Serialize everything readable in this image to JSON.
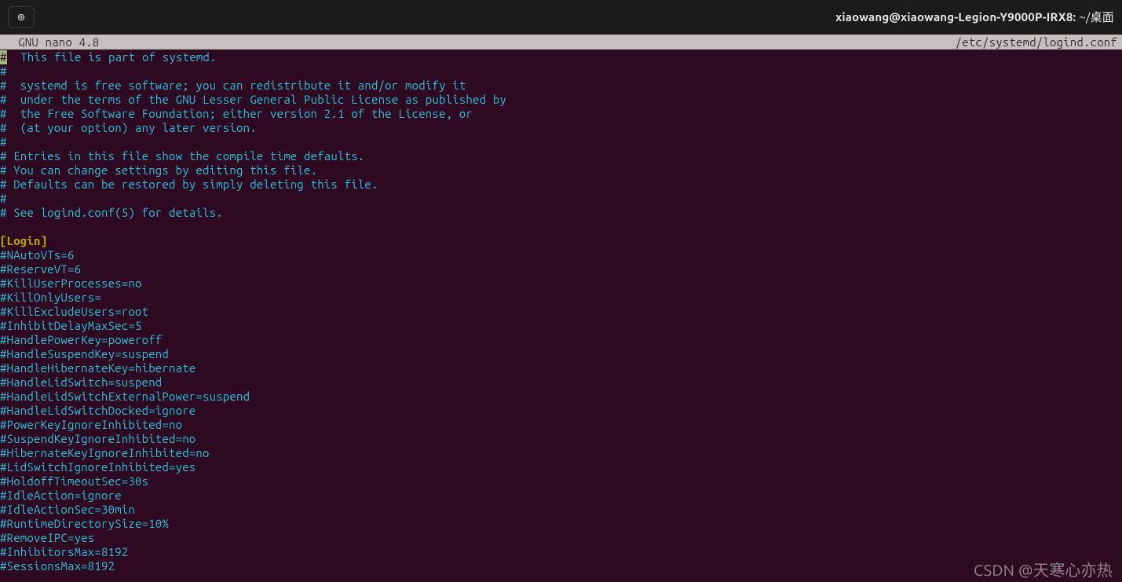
{
  "window": {
    "title_prefix": "xiaowang@xiaowang-Legion-Y9000P-IRX8: ",
    "title_path": "~/桌面",
    "new_tab_icon": "⊕"
  },
  "nano": {
    "app": "  GNU nano 4.8",
    "filename": "/etc/systemd/logind.conf"
  },
  "lines": [
    {
      "indent": " ",
      "text": "  This file is part of systemd.",
      "cls": "comment",
      "cursorFirst": true
    },
    {
      "text": "#",
      "cls": "comment"
    },
    {
      "text": "#  systemd is free software; you can redistribute it and/or modify it",
      "cls": "comment"
    },
    {
      "text": "#  under the terms of the GNU Lesser General Public License as published by",
      "cls": "comment"
    },
    {
      "text": "#  the Free Software Foundation; either version 2.1 of the License, or",
      "cls": "comment"
    },
    {
      "text": "#  (at your option) any later version.",
      "cls": "comment"
    },
    {
      "text": "#",
      "cls": "comment"
    },
    {
      "text": "# Entries in this file show the compile time defaults.",
      "cls": "comment"
    },
    {
      "text": "# You can change settings by editing this file.",
      "cls": "comment"
    },
    {
      "text": "# Defaults can be restored by simply deleting this file.",
      "cls": "comment"
    },
    {
      "text": "#",
      "cls": "comment"
    },
    {
      "text": "# See logind.conf(5) for details.",
      "cls": "comment"
    },
    {
      "text": " ",
      "cls": "blank"
    },
    {
      "text": "[Login]",
      "cls": "section"
    },
    {
      "text": "#NAutoVTs=6",
      "cls": "comment"
    },
    {
      "text": "#ReserveVT=6",
      "cls": "comment"
    },
    {
      "text": "#KillUserProcesses=no",
      "cls": "comment"
    },
    {
      "text": "#KillOnlyUsers=",
      "cls": "comment"
    },
    {
      "text": "#KillExcludeUsers=root",
      "cls": "comment"
    },
    {
      "text": "#InhibitDelayMaxSec=5",
      "cls": "comment"
    },
    {
      "text": "#HandlePowerKey=poweroff",
      "cls": "comment"
    },
    {
      "text": "#HandleSuspendKey=suspend",
      "cls": "comment"
    },
    {
      "text": "#HandleHibernateKey=hibernate",
      "cls": "comment"
    },
    {
      "text": "#HandleLidSwitch=suspend",
      "cls": "comment"
    },
    {
      "text": "#HandleLidSwitchExternalPower=suspend",
      "cls": "comment"
    },
    {
      "text": "#HandleLidSwitchDocked=ignore",
      "cls": "comment"
    },
    {
      "text": "#PowerKeyIgnoreInhibited=no",
      "cls": "comment"
    },
    {
      "text": "#SuspendKeyIgnoreInhibited=no",
      "cls": "comment"
    },
    {
      "text": "#HibernateKeyIgnoreInhibited=no",
      "cls": "comment"
    },
    {
      "text": "#LidSwitchIgnoreInhibited=yes",
      "cls": "comment"
    },
    {
      "text": "#HoldoffTimeoutSec=30s",
      "cls": "comment"
    },
    {
      "text": "#IdleAction=ignore",
      "cls": "comment"
    },
    {
      "text": "#IdleActionSec=30min",
      "cls": "comment"
    },
    {
      "text": "#RuntimeDirectorySize=10%",
      "cls": "comment"
    },
    {
      "text": "#RemoveIPC=yes",
      "cls": "comment"
    },
    {
      "text": "#InhibitorsMax=8192",
      "cls": "comment"
    },
    {
      "text": "#SessionsMax=8192",
      "cls": "comment"
    }
  ],
  "watermark": "CSDN @天寒心亦热"
}
